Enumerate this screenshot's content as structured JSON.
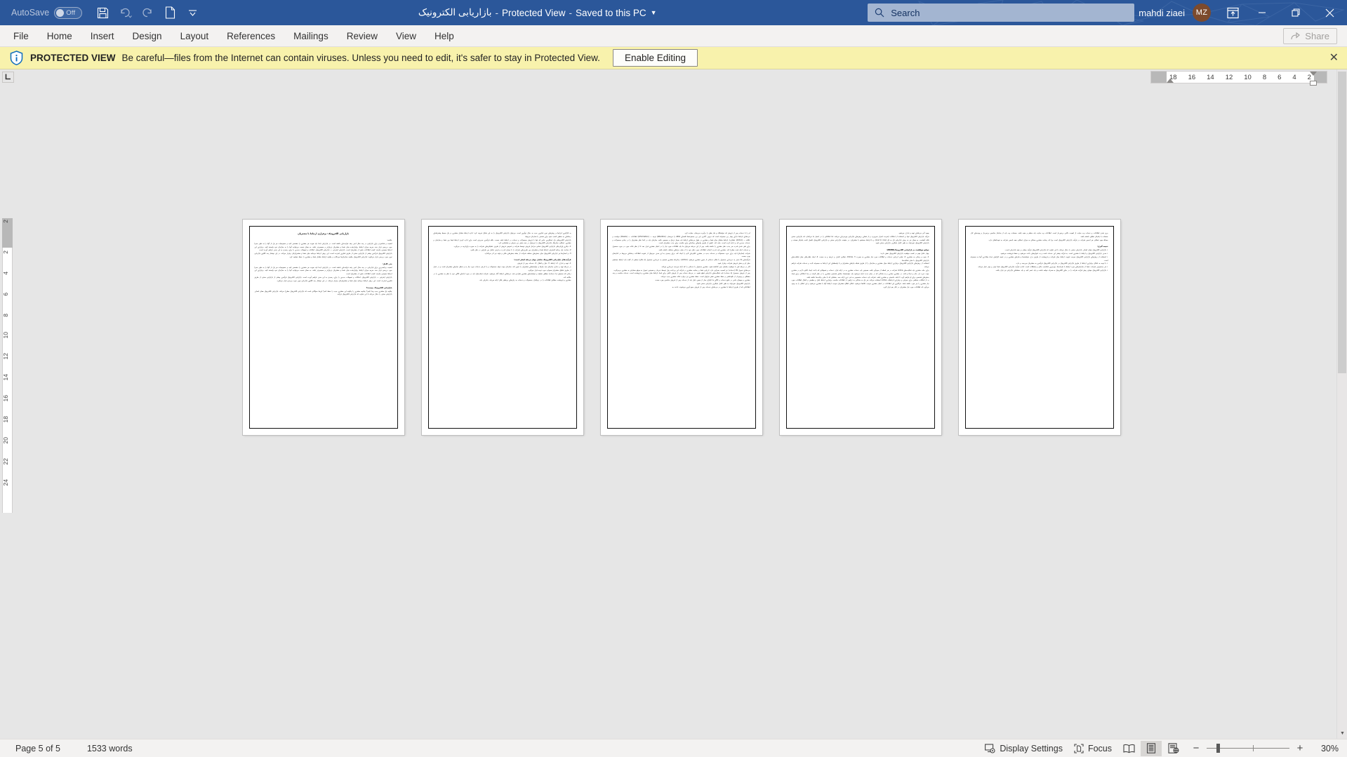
{
  "titlebar": {
    "autosave_label": "AutoSave",
    "autosave_state": "Off",
    "qat": [
      "save-icon",
      "undo-icon",
      "redo-icon",
      "new-blank-doc-icon",
      "customize-qat-icon"
    ],
    "doc_name": "بازاریابی الکترونیک",
    "protected_view_tag": "Protected View",
    "saved_state": "Saved to this PC",
    "search_placeholder": "Search",
    "user_name": "mahdi ziaei",
    "user_initials": "MZ",
    "window_buttons": [
      "minimize",
      "restore",
      "close"
    ]
  },
  "ribbon": {
    "tabs": [
      {
        "label": "File"
      },
      {
        "label": "Home"
      },
      {
        "label": "Insert"
      },
      {
        "label": "Design"
      },
      {
        "label": "Layout"
      },
      {
        "label": "References"
      },
      {
        "label": "Mailings"
      },
      {
        "label": "Review"
      },
      {
        "label": "View"
      },
      {
        "label": "Help"
      }
    ],
    "share_label": "Share"
  },
  "protected_view": {
    "icon": "shield-info-icon",
    "title": "PROTECTED VIEW",
    "message": "Be careful—files from the Internet can contain viruses. Unless you need to edit, it's safer to stay in Protected View.",
    "button_label": "Enable Editing",
    "close_label": "✕",
    "bar_color": "#f8f2ac"
  },
  "ruler": {
    "horizontal_ticks": [
      "18",
      "16",
      "14",
      "12",
      "10",
      "8",
      "6",
      "4",
      "2"
    ],
    "vertical_ticks": [
      "2",
      "2",
      "4",
      "6",
      "8",
      "10",
      "12",
      "14",
      "16",
      "18",
      "20",
      "22",
      "24"
    ],
    "tab_stop_marker": "left-tab-stop"
  },
  "document": {
    "pages": [
      {
        "number": 1,
        "title": "بازاریابی الکترونیک: برقراری ارتباط با مشتریان",
        "blocks": [
          {
            "type": "head",
            "text": "خلاصه:"
          },
          {
            "type": "para",
            "text": "اهمیت و شاخص‌تر برای بازاریابی در چند سال اخیر رشد فزاینده‌ای داشته است. در بازاریابی ابتدا باید هویت هر مشتری را مشخص کنید و خصوصیات هر یک از آنها را به طور مجزا مورد بررسی قرار دهد. هرچه میزان ارتباط برقرارشده میان شما و مشتریان نزدیک‌تر و صمیمی‌تر باشد، به همان نسبت می‌توانید آنها را به سازمان خود وابسته کنید. برقراری این ارتباط صمیمی نیازمند کسب اطلاعات دقیق از مشتریان است. بازاریابی اینترنتی — بازاریابی الکترونیک، امکانات و تسهیلات جدیدی را برای رسیدن به این هدف فراهم آورده است."
          },
          {
            "type": "para",
            "text": "بازاریابی الکترونیک فرآیندی بیشتر از بازاریابی سنتی از طریق فناوری اینترنت است. این روش ارتباط دوجانبه میان شما و مشتریان‌تان برقرار می‌کند. در این نوشتار چند الگوی بازاریابی نوین مورد بررسی قرار می‌گوید: بازاریابی الکترونیک چگونه سازمان‌ها می‌نگارد و چگونه ارتباط متقابل شما و مشتری را حفظ خواهید کرد."
          },
          {
            "type": "head",
            "text": "متن کامل:"
          },
          {
            "type": "para",
            "text": "اهمیت برنامه‌ریزی برای بازاریابی در چند سال اخیر رشد فزاینده‌ای داشته است. در بازاریابی ابتدا باید هویت هر مشتری را مشخص کنید و خصوصیات هر یک از آنها را به طور مجزا مورد بررسی قرار دهد. هرچه میزان ارتباط برقرارشده میان شما و مشتریان نزدیک‌تر و صمیمی‌تر باشد، به همان نسبت می‌توانید آنها را به سازمان خود وابسته کنید. برقراری این ارتباط صمیمی نیازمند کسب اطلاعات دقیق از مشتریان است."
          },
          {
            "type": "para",
            "text": "بازاریابی اینترنتی — بازاریابی الکترونیک، امکانات و تسهیلات جدیدی را برای رسیدن به این هدف فراهم آورده است. بازاریابی الکترونیک فرآیندی بیشتر از بازاریابی سنتی از طریق فناوری اینترنت است. این روش ارتباط دوجانبه میان شما و مشتریان‌تان برقرار می‌کند. در این نوشتار چند الگوی بازاریابی نوین مورد بررسی قرار می‌گیرد."
          },
          {
            "type": "head",
            "text": "بازاریابی الکترونیک چیست؟"
          },
          {
            "type": "para",
            "text": "چگونه یک مشتری جدید پیدا کنیم؟ چنانچه مشتری را چگونه این مشتری جدید را حفظ کنم؟ این‌ها سؤالاتی است که بازاریابی الکترونیک مطرح می‌کند. بازاریابی الکترونیک همان اهداف بازاریابی سنتی را دنبال می‌کند با این تفاوت که بازاریابی الکترونیک فرآیند."
          }
        ]
      },
      {
        "number": 2,
        "title": "",
        "blocks": [
          {
            "type": "para",
            "text": "به کارگیری ابزارها و روش‌های نوین فناوری جدید به دنبال نوآوری است. می‌توان بازاریابی الکترونیک را به این شکل تعریف کرد: اداره ارتباط متقابل مشتری در یک محیط پیشرفته‌ای رسانه‌ای به منظور کسب سود برای شخص یا سازمان مربوط."
          },
          {
            "type": "para",
            "text": "بازاریابی الکترونیکی یک عملکردی خاص که تنها با فروش محصولات و خدمات در ارتباط باشد نیست. بلکه فرآیندی مدیریتی است برای اداره کردن ارتباط فیما بین شما و سازمان و مشتری. عملکرد سازوکار بازاریابی الکترونیک را می‌توان در سه بخش زیر معرفی و شناسایی کرد:"
          },
          {
            "type": "para",
            "text": "1- دیگری یک‌پارچگی بازاریابی الکترونیک تمامی مراحل فروش توسط شرکت و عمومی فروش از طریق عملیاتی‌های شرکت را به صورت یک‌پارچه در می‌آورد."
          },
          {
            "type": "para",
            "text": "2- مباحث یک برنامه گسترش ارتباط شما و مشتریان بین طرف‌های شرکت را با میزان قدرت و فرض تعامل بین طرفین در نظر بگیرد."
          },
          {
            "type": "para",
            "text": "3- و انسان‌ها نیز بازاریابی الکترونیک میان بخش‌های مختلف شرکت از جمله بخش‌های مالی و تولید نیز اثر می‌گذارد."
          },
          {
            "type": "head",
            "text": "فرآیندهای بازاریابی الکترونیک شامل چهار مرحله اصلی است:"
          },
          {
            "type": "para",
            "text": "1- تهیه و تدارک.\n2- ارتباط.\n3- نقل و انتقال.\n4- خدمات پس از فروش."
          },
          {
            "type": "para",
            "text": "در مرحله تهیه و تدارک سازمان باید نیازها و خواسته‌های مشتریان را تعیین کند. سازمان جهت تولید محصولات و با ارزش خدمات مورد نیاز به و تحلیل نیازهای مشتریان است و در عمل از طریق تفکیک مشتریان همواره مورد توجه قرار می‌گیرد."
          },
          {
            "type": "para",
            "text": "زمانی که محصول (یا خدمات) مطابق سلیقه و خواسته‌های مشتری طراحی شد، مرحله‌ای ارتباط آغاز می‌شود. شرکت (سازمان) باید در مورد ارائه‌ای کالای خود را نظر به مشتری را در مکاتبه کند."
          },
          {
            "type": "para",
            "text": "مشتری و فروشنده مطابق اطلاعات را در نرم‌افزار محصولات و خدمات به زبان‌های بی‌نظیر قابل ارائه می‌یابد. بنابراین باید."
          }
        ]
      },
      {
        "number": 3,
        "title": "",
        "blocks": [
          {
            "type": "para",
            "text": "او را با خدمات پس از فروش که خواستگاه و نیاز طبق را برآورده می‌سازد حمایت کرد."
          },
          {
            "type": "para",
            "text": "مرحله‌ای ارتباط دارای چهار زیر مجموعه است که حروف آغازین این زیر مجموعه‌ها کلمه‌ای AIDA را می‌سازد (Attention) توجه — (Information) اطلاعات — (Desire) خواست و علاقه — (Action) عملکرد). ارتباط متقابل میان شما و مشتری در طول مرحله‌ای ارتباط باید بسیار نزدیک و صمیمی باشد. سازمان باید در ابتدا نظر مشتریان را در زمانی محصولات و خدمات جدیدی که بر ارائه کرده است، جلب کند. تلفیق از طریق پیام‌های رسانه‌ای برای مناسب برای جذب مشتریان است."
          },
          {
            "type": "para",
            "text": "برای طی شدن قدرت هر جذب نظر مشتری را داشته باشد. پس از این مرحله می‌توان ما باید اطلاعات مورد نیاز را در اختیار مشتری قرار دهد تا از نظر نکات مورد در مورد محصول و خدمات ارائه شده مطرح کند. مشتری باید قدرت انتخاب اطلاعات مورد نظر خود را از میان جزء‌های مختلف داشته باشد."
          },
          {
            "type": "para",
            "text": "شرکت (سازمان) باید برای خرید محصولات و خدمات جدید در مشتری انگیزه‌ای لازم را ایجاد کند. برای رسیدن به این هدف می‌توان از تقویت اطلاعات رسانه‌ای مربوط در کنارشان بهره جست."
          },
          {
            "type": "para",
            "text": "فرآیندهای بالا منجر به خریداری محصول یا مکان خدماتی از سوی مشتری می‌شود (Action). زمانی‌که مشتری تصمیم به خریداری محصول (یا مکان) بخشی از گفت باید ارتباط مستقیم میان او و بخش فروش شرکت برقرار شود."
          },
          {
            "type": "para",
            "text": "اگر در مرحله اول با موفقیت یکسان سیر گذاشته شود، مشتری محصول یا خدماتی را که ارائه می‌دهد خریداری می‌کند."
          },
          {
            "type": "para",
            "text": "مرحله‌ای تحویل کالا (خدمات) نیز اهمیت بسزایی دارد. ارزیابی شما و رضایت مشتری در فرآیند این پرداخت پول توسط خریدار و همچنین تحویل به موقع سفارش به مشتری برمی‌گردد."
          },
          {
            "type": "para",
            "text": "پس از فروش محصول (یا خدمات) باید فعالیت‌های بازاریابی قطع نشود. در مرحله خدمات پس از فروش تلاش برای ایجاد ارتباط میان مشتری و فروشنده است. خدمات مناسب و چند مشکلی و پرهیزدار از نگهداشتن و حفظ مشتری نقش فراوان است. حفظ مشتری نیز دوباره نکات مشتری جدید می‌کند."
          },
          {
            "type": "para",
            "text": "مشتری و میهمان خاص در تبلیغ خدمات و کالای ما ایگران سار از همین دلیل باید از خدمات پس از فروش مناسبی بهره جست."
          },
          {
            "type": "para",
            "text": "بازاریابی الکترونیک نمی‌تواند به طور کامل جایگزین بازاریابی سنتی شود."
          },
          {
            "type": "para",
            "text": "اطلاعاتی که از طریق ارتباط با مشتری در مرحله‌ای خدمات پس از فروش جمع آوری می‌شوند، باعث به."
          }
        ]
      },
      {
        "number": 4,
        "title": "",
        "blocks": [
          {
            "type": "para",
            "text": "بهبود آتی مرحله‌ای تهیه و تدارک می‌شود."
          },
          {
            "type": "para",
            "text": "فرآیند بازاریابی الکترونیک تنها بر استفاده از امکانات اینترنت اصرار نمی‌ورزد و از فضای روش‌های بازاریابی بهره‌بردای می‌کند، اما امکاناتی را در اختیار ما می‌گذارد که بازاریابی سنتی فاقد آنهاست. به همان نیز نه روش بازاریابی تک به تک (one to one) و یا ارتباط مستقیم با مشتریان. در حقیقت بازاریابی سنتی و بازاریابی الکترونیک تکمیل کننده یکدیگر هستند و بازاریابی الکترونیک نمی‌تواند به طور کامل جایگزین بازاریابی سنتی شود."
          },
          {
            "type": "head",
            "text": "موانع موفقیت در بازاریابی الکترونیک(BONI):"
          },
          {
            "type": "para",
            "text": "چهار عامل مهم در کسب موفقیت بازاریابی الکترونیک نقش دارند:"
          },
          {
            "type": "para",
            "text": "1- سود و رسانی به مشتری.\n2- توانی ارزیابی خدمات و اطلاعات مورد نیاز مشتری به صورت Online.\n3- توانایی کنترل و عرضه و به سمت.\n4- ایجاد یکپارچگی میان فعالیت‌های بازاریابی الکترونیک با سایر فعالیت‌ها."
          },
          {
            "type": "para",
            "text": "استفاده از روش‌های بازاریابی الکترونیک برقراری ارتباط میان مشتری و سازمان را از طریق شبکه نیازهای مشتریان و با واسطه‌ای این ارتباط به مجموعه ثابت و خدمات شرکت فراهم می‌کند."
          },
          {
            "type": "para",
            "text": "برای جلب مشتری باید فعالیت‌های online شرکت در هر لحظه از سودآور باشد. همچنین باید خدمات مشتری به در ارائه قرار، خدمات و تسهیلاتی که باعث ایجاد انگیزه لازم در مشتری جهت خرید (در حال و تبدا) و کنند. در مشتری مجازی و به سادگی که در زمان مدت ارائه می‌شود باید خواسته‌ها، سلایق شخصی مشتری را در نظر گرفت و جدا امکاناتی برای ایجاد بخش‌های شخصی برای او فراهم آورد تا باشد خاصیتی و مشتری باشد. شرکت باید خدمات مخصوص به فرد تری ارائه دهد. بخشانی که با سایر رقابت‌ها داشته باشد."
          },
          {
            "type": "para",
            "text": "بد از امکانات مختلفی برای معرفی و برقراری ارتباطات online استفاده می‌کند. هر یک به سادگی به ترکیبی از اطلاعات مناسب برقراری ارتباط امان و مطمئن و انتقال اطلاعات مورد نیاز مشتری را نیز مورد داشته باشد. فراگیری این اطلاعات در اختیار مشتری موجب نگاه‌ها می‌شود. امکان اطلاع مشتریان موجب ارتباط آنها با مشتری می‌شود و این امکان را به وجود می‌آورد که اطلاعات مورد نیاز مشتریان در کنار هم قرار گیرد."
          }
        ]
      },
      {
        "number": 5,
        "title": "",
        "blocks": [
          {
            "type": "para",
            "text": "بروز شدن اطلاعات و خدمات وب سایت از اهمیت بالایی برخوردار است. اطلاعات وب سایت باید منظم و مفید باشد. صفحات وب باید از ساختار مناسبی برخوردار و پیوندهای کار، صفحات با یکدیگر تطابق داشته باشد."
          },
          {
            "type": "para",
            "text": "مساله مهم عملکرد هر انجمن شرکت در فرآیند بازاریابی الکترونیک است چرا که رضایت مشتری بستگی به میزان عملکرد همه انجمن شرکت به تعهداتشان دارد."
          },
          {
            "type": "head",
            "text": "نتیجه گیری:"
          },
          {
            "type": "para",
            "text": "• بازاریابی الکترونیک همان اهداف بازاریابی سنتی را دنبال می‌کند با این تفاوت که بازاریابی الکترونیک فرآیند بیشتر بر همه بازاریابی است."
          },
          {
            "type": "para",
            "text": "• هدف بازاریابی الکترونیک و ارتباط با مشتری است. به فرآیند بیشتر این خدمات است و به عنوان‌هایی باعث می‌شود و حفظ فروشنده می‌شود."
          },
          {
            "type": "para",
            "text": "• استفاده از روش‌های بازاریابی الکترونیک موجب تقویت ارتباط میان شرکت و فروشنده از طریق درک خواسته‌ها و نیازهای مشتری و در نتیجه افزایش تعداد وفاداری آنها به مجموعه است."
          },
          {
            "type": "para",
            "text": "• با توجه به امکان برقراری ارتباط از طریق بازاریابی الکترونیک در بازاریابی الکترونیک فرآیندی به مشتریان می‌رسد و دارد."
          },
          {
            "type": "para",
            "text": "• هر به‌خصوص شرکت، شما از سازمان‌های مورد ارتباط با شرکت‌ها، بهره‌وری نامناسب مالی و مشکلات است. اندازه فرآیند بازاریابی الکترونیک شما موثر و بهتر عمل می‌کند."
          },
          {
            "type": "para",
            "text": "• بازاریابی الکترونیک موفق، پیش فرآیند شرکت را در دنیای الکترونیک به همراه خواهد داشت و باید عصر کنید و باید حفظ‌های بازاریابی نیز قرار باشد."
          }
        ]
      }
    ]
  },
  "statusbar": {
    "page_info": "Page 5 of 5",
    "word_count": "1533 words",
    "display_settings": "Display Settings",
    "focus": "Focus",
    "view_modes": [
      {
        "name": "read-mode",
        "selected": false
      },
      {
        "name": "print-layout",
        "selected": true
      },
      {
        "name": "web-layout",
        "selected": false
      }
    ],
    "zoom_out": "−",
    "zoom_in": "+",
    "zoom_level": "30%"
  }
}
